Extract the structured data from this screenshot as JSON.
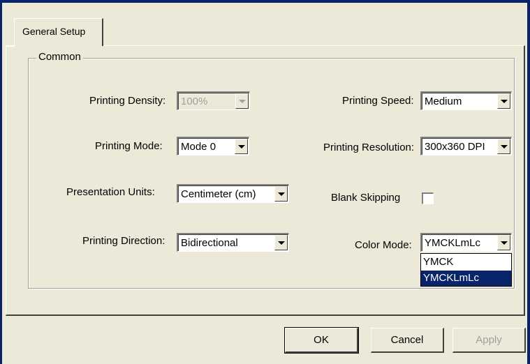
{
  "tabs": [
    {
      "label": "General Setup"
    }
  ],
  "group": {
    "label": "Common"
  },
  "fields": {
    "printing_density": {
      "label": "Printing Density:",
      "value": "100%"
    },
    "printing_mode": {
      "label": "Printing Mode:",
      "value": "Mode 0"
    },
    "presentation_units": {
      "label": "Presentation Units:",
      "value": "Centimeter (cm)"
    },
    "printing_direction": {
      "label": "Printing Direction:",
      "value": "Bidirectional"
    },
    "printing_speed": {
      "label": "Printing Speed:",
      "value": "Medium"
    },
    "printing_resolution": {
      "label": "Printing Resolution:",
      "value": "300x360 DPI"
    },
    "blank_skipping": {
      "label": "Blank Skipping",
      "checked": false
    },
    "color_mode": {
      "label": "Color Mode:",
      "value": "YMCKLmLc",
      "options": [
        "YMCK",
        "YMCKLmLc"
      ],
      "selected_option": "YMCKLmLc"
    }
  },
  "buttons": {
    "ok": "OK",
    "cancel": "Cancel",
    "apply": "Apply"
  },
  "colors": {
    "selection": "#0a246a",
    "face": "#ece9d8"
  }
}
